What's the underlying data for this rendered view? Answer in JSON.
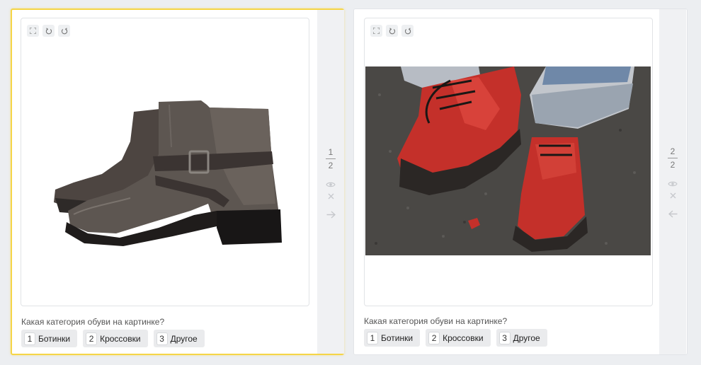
{
  "tasks": [
    {
      "question": "Какая категория обуви на картинке?",
      "answers": [
        {
          "key": "1",
          "label": "Ботинки"
        },
        {
          "key": "2",
          "label": "Кроссовки"
        },
        {
          "key": "3",
          "label": "Другое"
        }
      ],
      "counter": {
        "current": "1",
        "total": "2"
      },
      "image": "grey-ankle-boots-photo",
      "next_icon": "arrow-right-icon"
    },
    {
      "question": "Какая категория обуви на картинке?",
      "answers": [
        {
          "key": "1",
          "label": "Ботинки"
        },
        {
          "key": "2",
          "label": "Кроссовки"
        },
        {
          "key": "3",
          "label": "Другое"
        }
      ],
      "counter": {
        "current": "2",
        "total": "2"
      },
      "image": "red-boots-on-asphalt-photo",
      "prev_icon": "arrow-left-icon"
    }
  ],
  "tools": [
    "fullscreen-icon",
    "rotate-left-icon",
    "rotate-right-icon"
  ],
  "colors": {
    "active_border": "#f5d547",
    "page_bg": "#eceef1",
    "button_bg": "#eaebed"
  }
}
